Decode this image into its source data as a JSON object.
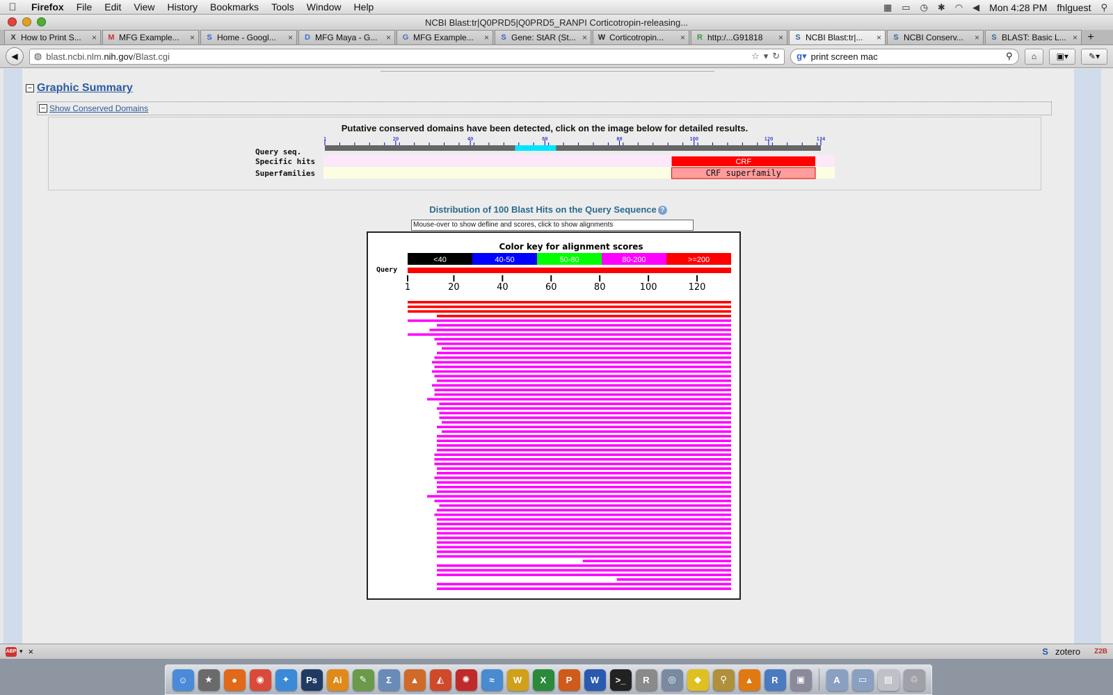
{
  "menubar": {
    "app": "Firefox",
    "items": [
      "File",
      "Edit",
      "View",
      "History",
      "Bookmarks",
      "Tools",
      "Window",
      "Help"
    ],
    "clock": "Mon 4:28 PM",
    "user": "fhlguest"
  },
  "window": {
    "title": "NCBI Blast:tr|Q0PRD5|Q0PRD5_RANPI Corticotropin-releasing..."
  },
  "tabs": [
    {
      "label": "How to Print S...",
      "icon": "X",
      "color": "#333333"
    },
    {
      "label": "MFG Example...",
      "icon": "M",
      "color": "#cc3333"
    },
    {
      "label": "Home - Googl...",
      "icon": "S",
      "color": "#3366cc"
    },
    {
      "label": "MFG Maya - G...",
      "icon": "D",
      "color": "#3b6fd4"
    },
    {
      "label": "MFG Example...",
      "icon": "G",
      "color": "#4a6fb8"
    },
    {
      "label": "Gene: StAR (St...",
      "icon": "S",
      "color": "#3366cc"
    },
    {
      "label": "Corticotropin...",
      "icon": "W",
      "color": "#222222"
    },
    {
      "label": "http:/...G91818",
      "icon": "R",
      "color": "#3a9a3a"
    },
    {
      "label": "NCBI Blast:tr|...",
      "icon": "S",
      "color": "#336699",
      "active": true
    },
    {
      "label": "NCBI Conserv...",
      "icon": "S",
      "color": "#336699"
    },
    {
      "label": "BLAST: Basic L...",
      "icon": "S",
      "color": "#336699"
    }
  ],
  "nav": {
    "url_prefix": "blast.ncbi.nlm.",
    "url_host": "nih.gov",
    "url_path": "/Blast.cgi",
    "search_value": "print screen mac"
  },
  "page": {
    "graphic_summary": "Graphic Summary",
    "show_conserved": "Show Conserved Domains",
    "conserved_msg": "Putative conserved domains have been detected, click on the image below for detailed results.",
    "row_query": "Query seq.",
    "row_specific": "Specific hits",
    "row_super": "Superfamilies",
    "domain_crf": "CRF",
    "domain_super": "CRF superfamily",
    "cd_ticks": [
      "1",
      "20",
      "40",
      "60",
      "80",
      "100",
      "120",
      "134"
    ],
    "dist_title": "Distribution of 100 Blast Hits on the Query Sequence",
    "mouseover": "Mouse-over to show defline and scores, click to show alignments",
    "color_key_title": "Color key for alignment scores",
    "color_key": [
      {
        "label": "<40",
        "color": "#000000"
      },
      {
        "label": "40-50",
        "color": "#0000ff"
      },
      {
        "label": "50-80",
        "color": "#00ff00"
      },
      {
        "label": "80-200",
        "color": "#ff00ff"
      },
      {
        "label": ">=200",
        "color": "#ff0000"
      }
    ],
    "query_label": "Query",
    "axis_ticks": [
      "1",
      "20",
      "40",
      "60",
      "80",
      "100",
      "120"
    ]
  },
  "hits": {
    "query_length": 134,
    "starts": [
      1,
      1,
      1,
      13,
      1,
      13,
      10,
      1,
      12,
      13,
      15,
      13,
      12,
      11,
      12,
      11,
      12,
      13,
      11,
      12,
      12,
      9,
      14,
      13,
      14,
      14,
      15,
      13,
      15,
      13,
      13,
      13,
      13,
      12,
      12,
      12,
      13,
      13,
      12,
      13,
      13,
      13,
      9,
      12,
      14,
      13,
      12,
      13,
      13,
      13,
      13,
      13,
      13,
      13,
      13,
      13,
      73,
      13,
      13,
      13,
      87,
      13,
      13
    ],
    "colors": [
      "#ff0000",
      "#ff0000",
      "#ff0000",
      "#ff0000"
    ]
  },
  "statusbar": {
    "zotero": "zotero",
    "z2b": "Z2B"
  },
  "dock": [
    {
      "name": "finder-icon",
      "color": "#4b8ad8",
      "glyph": "☺"
    },
    {
      "name": "imovie-icon",
      "color": "#6a6a6a",
      "glyph": "★"
    },
    {
      "name": "firefox-icon",
      "color": "#e06a1a",
      "glyph": "●"
    },
    {
      "name": "chrome-icon",
      "color": "#d94a3a",
      "glyph": "◉"
    },
    {
      "name": "safari-icon",
      "color": "#3a8ad8",
      "glyph": "✦"
    },
    {
      "name": "photoshop-icon",
      "color": "#1f3b62",
      "glyph": "Ps"
    },
    {
      "name": "illustrator-icon",
      "color": "#e08a1a",
      "glyph": "Ai"
    },
    {
      "name": "preview-icon",
      "color": "#6a9a4a",
      "glyph": "✎"
    },
    {
      "name": "math-icon",
      "color": "#6a8ab8",
      "glyph": "Σ"
    },
    {
      "name": "maple-icon",
      "color": "#d06a2a",
      "glyph": "▲"
    },
    {
      "name": "matlab-icon",
      "color": "#d04a2a",
      "glyph": "◭"
    },
    {
      "name": "mathematica-icon",
      "color": "#c02a2a",
      "glyph": "✺"
    },
    {
      "name": "fetch-icon",
      "color": "#4a8ad0",
      "glyph": "≈"
    },
    {
      "name": "textwrangler-icon",
      "color": "#d0a01a",
      "glyph": "W"
    },
    {
      "name": "excel-icon",
      "color": "#2a8a3a",
      "glyph": "X"
    },
    {
      "name": "powerpoint-icon",
      "color": "#d05a1a",
      "glyph": "P"
    },
    {
      "name": "word-icon",
      "color": "#2a5ab0",
      "glyph": "W"
    },
    {
      "name": "terminal-icon",
      "color": "#222222",
      "glyph": ">_"
    },
    {
      "name": "r-icon",
      "color": "#8a8a8a",
      "glyph": "R"
    },
    {
      "name": "network-icon",
      "color": "#7a8aa0",
      "glyph": "◎"
    },
    {
      "name": "cyberduck-icon",
      "color": "#e0c020",
      "glyph": "◆"
    },
    {
      "name": "microscope-icon",
      "color": "#b0903a",
      "glyph": "⚲"
    },
    {
      "name": "vlc-icon",
      "color": "#e07a10",
      "glyph": "▲"
    },
    {
      "name": "rstudio-icon",
      "color": "#4a7ac0",
      "glyph": "R"
    },
    {
      "name": "photos-icon",
      "color": "#8a8a9a",
      "glyph": "▣"
    },
    {
      "name": "applications-folder-icon",
      "color": "#8aa0c0",
      "glyph": "A"
    },
    {
      "name": "documents-folder-icon",
      "color": "#8aa0c0",
      "glyph": "▭"
    },
    {
      "name": "downloads-stack-icon",
      "color": "#c0c0c8",
      "glyph": "▤"
    },
    {
      "name": "trash-icon",
      "color": "#a0a0a8",
      "glyph": "♲"
    }
  ]
}
